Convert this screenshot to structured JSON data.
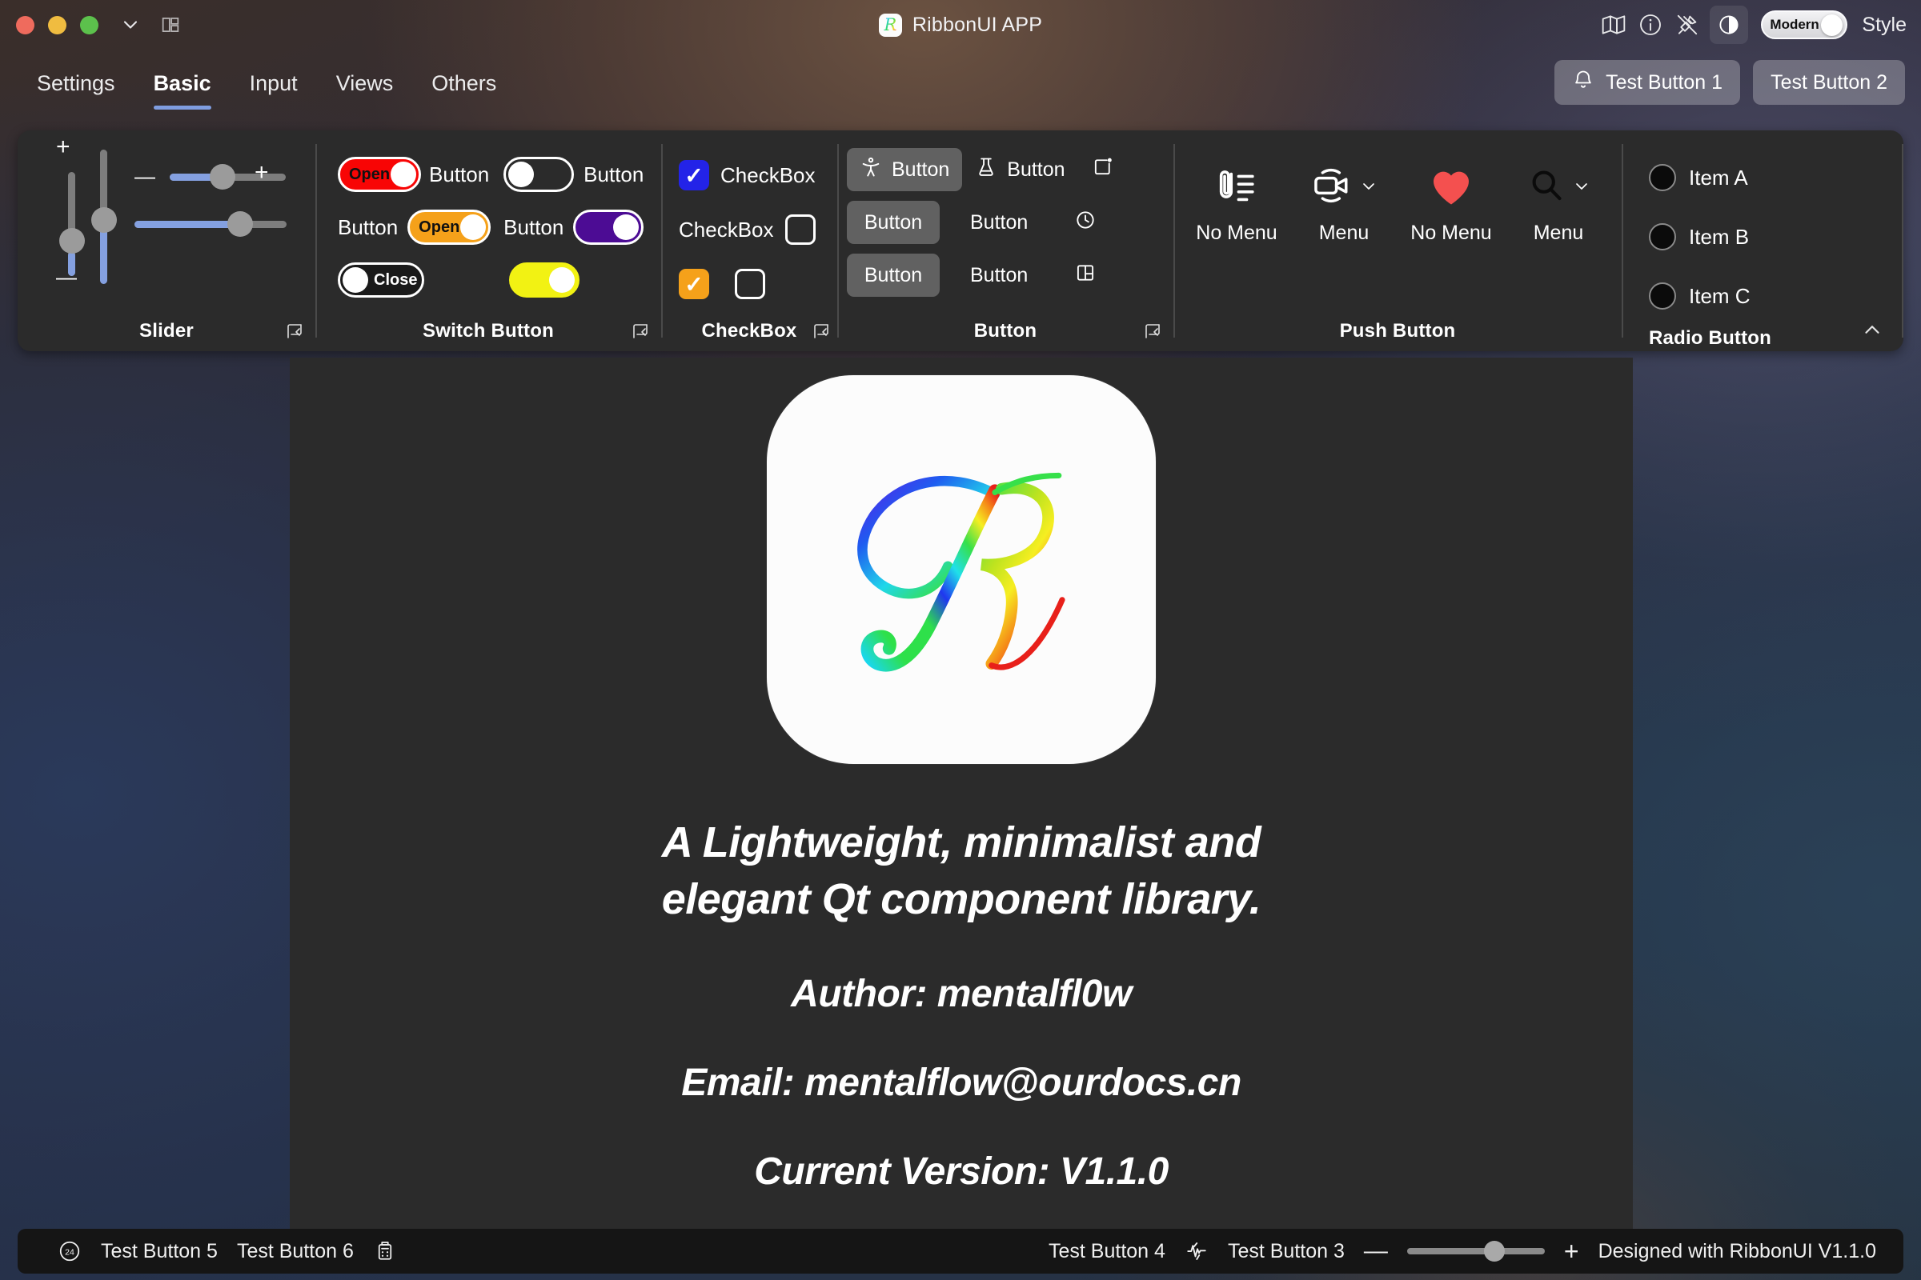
{
  "window": {
    "title": "RibbonUI APP",
    "logo_letter": "R",
    "traffic_lights": [
      "close",
      "minimize",
      "maximize"
    ],
    "chevron_icon": "chevron-down-icon",
    "grid_icon": "grid-layout-icon",
    "right_icons": [
      "map-icon",
      "info-icon",
      "unpin-icon"
    ],
    "theme_icon": "contrast-half-circle-icon",
    "style_switch": {
      "label": "Modern",
      "state": "on"
    },
    "style_word": "Style"
  },
  "tabs": [
    {
      "label": "Settings",
      "active": false
    },
    {
      "label": "Basic",
      "active": true
    },
    {
      "label": "Input",
      "active": false
    },
    {
      "label": "Views",
      "active": false
    },
    {
      "label": "Others",
      "active": false
    }
  ],
  "tab_actions": [
    {
      "label": "Test Button 1",
      "icon": "bell-icon"
    },
    {
      "label": "Test Button 2",
      "icon": ""
    }
  ],
  "ribbon": {
    "collapse_icon": "chevron-up-icon",
    "expander_icon": "dialog-launcher-icon",
    "groups": [
      {
        "title": "Slider",
        "has_expander": true,
        "sliders": {
          "vertical": [
            {
              "plus": "+",
              "minus": "—",
              "value_pct": 22
            },
            {
              "value_pct": 52
            }
          ],
          "horizontal": [
            {
              "minus": "—",
              "plus": "+",
              "value_pct": 58
            },
            {
              "value_pct": 78
            }
          ]
        }
      },
      {
        "title": "Switch Button",
        "has_expander": true,
        "switches": [
          {
            "text": "Open",
            "color": "#f80505",
            "state": "on",
            "label": "Button",
            "label_side": "right"
          },
          {
            "text": "",
            "color": "#2b2b2b",
            "state": "off",
            "label": "Button",
            "label_side": "right"
          },
          {
            "text": "Open",
            "color": "#f5a11a",
            "state": "on",
            "label": "Button",
            "label_side": "left"
          },
          {
            "text": "",
            "color": "#4c0c94",
            "state": "on",
            "label": "Button",
            "label_side": "left"
          },
          {
            "text": "Close",
            "color": "#1a1a1a",
            "state": "off",
            "label": "",
            "label_side": "none"
          },
          {
            "text": "",
            "color": "#f2f213",
            "state": "on",
            "label": "",
            "label_side": "none"
          }
        ]
      },
      {
        "title": "CheckBox",
        "has_expander": true,
        "checkboxes": [
          {
            "checked": true,
            "color": "#2323e8",
            "label": "CheckBox",
            "label_side": "right"
          },
          {
            "checked": false,
            "color": "",
            "label": "CheckBox",
            "label_side": "left"
          },
          {
            "checked": true,
            "color": "#f5a11a",
            "label": "",
            "label_side": "none"
          },
          {
            "checked": false,
            "color": "",
            "label": "",
            "label_side": "none"
          }
        ]
      },
      {
        "title": "Button",
        "has_expander": true,
        "buttons": [
          {
            "label": "Button",
            "icon": "accessibility-icon",
            "filled": true
          },
          {
            "label": "Button",
            "icon": "flask-icon",
            "filled": false
          },
          {
            "label": "",
            "icon": "new-window-dot-icon",
            "filled": false
          },
          {
            "label": "Button",
            "icon": "",
            "filled": true
          },
          {
            "label": "Button",
            "icon": "",
            "filled": false
          },
          {
            "label": "",
            "icon": "clock-icon",
            "filled": false
          },
          {
            "label": "Button",
            "icon": "",
            "filled": true
          },
          {
            "label": "Button",
            "icon": "",
            "filled": false
          },
          {
            "label": "",
            "icon": "layout-panel-icon",
            "filled": false
          }
        ]
      },
      {
        "title": "Push Button",
        "has_expander": false,
        "push_buttons": [
          {
            "label": "No Menu",
            "icon": "attachment-list-icon",
            "menu": false,
            "color": "#ffffff"
          },
          {
            "label": "Menu",
            "icon": "video-camera-icon",
            "menu": true,
            "color": "#ffffff"
          },
          {
            "label": "No Menu",
            "icon": "heart-icon",
            "menu": false,
            "color": "#f4504f"
          },
          {
            "label": "Menu",
            "icon": "search-icon",
            "menu": true,
            "color": "#0b0b0b"
          }
        ]
      },
      {
        "title": "Radio Button",
        "has_expander": false,
        "radios": [
          {
            "label": "Item A",
            "selected": false
          },
          {
            "label": "Item B",
            "selected": false
          },
          {
            "label": "Item C",
            "selected": false
          }
        ]
      }
    ]
  },
  "content": {
    "logo_letter": "R",
    "tagline_line1": "A Lightweight, minimalist and",
    "tagline_line2": "elegant Qt component library.",
    "author": "Author: mentalfl0w",
    "email": "Email: mentalflow@ourdocs.cn",
    "version": "Current Version: V1.1.0"
  },
  "statusbar": {
    "left": [
      {
        "type": "icon",
        "name": "twenty-four-circle-icon",
        "label": "24"
      },
      {
        "type": "text",
        "label": "Test Button 5"
      },
      {
        "type": "text",
        "label": "Test Button 6"
      },
      {
        "type": "icon",
        "name": "calculator-icon",
        "label": ""
      }
    ],
    "right": [
      {
        "type": "text",
        "label": "Test Button 4"
      },
      {
        "type": "icon",
        "name": "activity-pulse-icon",
        "label": ""
      },
      {
        "type": "text",
        "label": "Test Button 3"
      },
      {
        "type": "icon",
        "name": "minus-icon",
        "label": "—"
      },
      {
        "type": "slider",
        "value_pct": 58
      },
      {
        "type": "icon",
        "name": "plus-icon",
        "label": "+"
      },
      {
        "type": "text",
        "label": "Designed with RibbonUI V1.1.0"
      }
    ]
  },
  "colors": {
    "accent": "#7f9de0",
    "ribbon_bg": "#2b2b2b",
    "content_bg": "#2b2b2b",
    "statusbar_bg": "#151515"
  }
}
